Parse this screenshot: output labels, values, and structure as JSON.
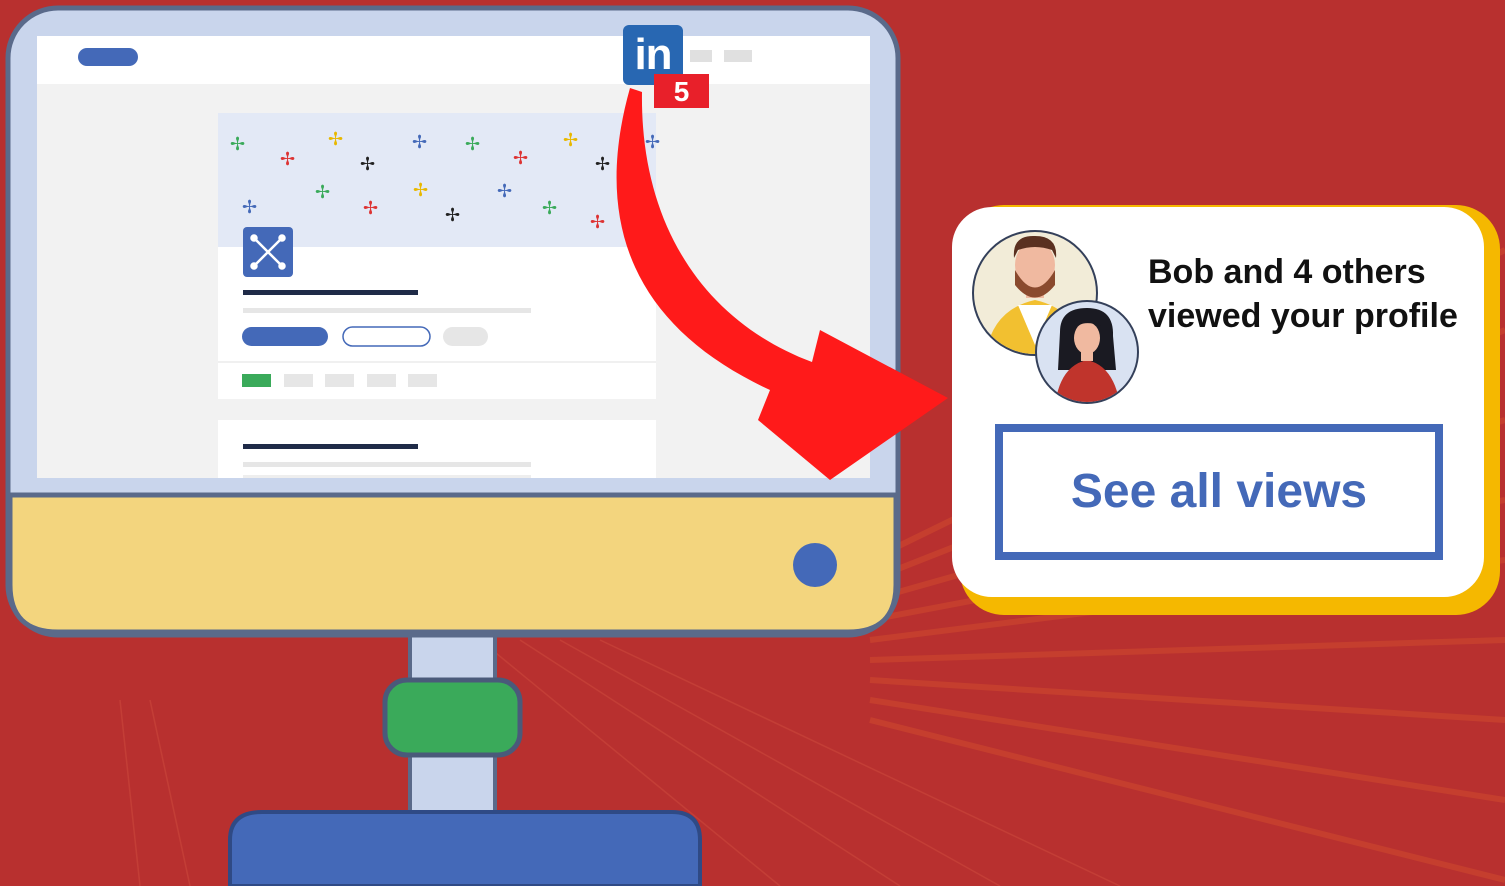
{
  "linkedin": {
    "logo_text": "in",
    "notification_count": "5"
  },
  "notification": {
    "line1": "Bob and 4 others",
    "line2": "viewed your profile",
    "button_label": "See all views"
  },
  "colors": {
    "background": "#b8302f",
    "monitor_frame": "#c9d5ec",
    "monitor_base": "#f3d57e",
    "stand_knob": "#3aaa5a",
    "stand_base": "#4469b8",
    "linkedin_blue": "#2867b2",
    "badge_red": "#e8202a",
    "card_accent": "#f5b800",
    "button_blue": "#4469b8",
    "arrow_red": "#ff1a1a"
  },
  "icons": {
    "company_logo": "company-logo-icon",
    "sparkles": "sparkle-icon",
    "avatars": [
      "man-avatar-icon",
      "woman-avatar-icon"
    ]
  }
}
